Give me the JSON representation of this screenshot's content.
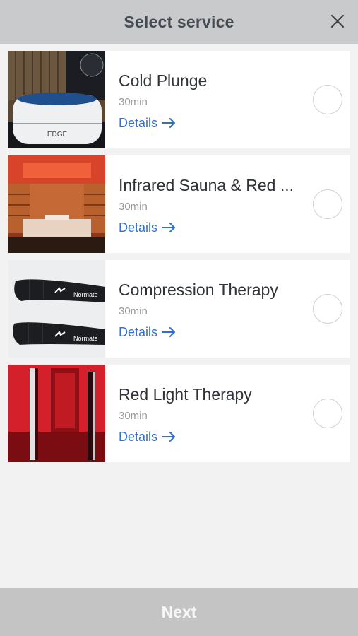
{
  "header": {
    "title": "Select service",
    "close_icon": "close-icon"
  },
  "services": [
    {
      "title": "Cold Plunge",
      "duration": "30min",
      "details": "Details",
      "image": "cold-plunge-tub-image"
    },
    {
      "title": "Infrared Sauna & Red ...",
      "duration": "30min",
      "details": "Details",
      "image": "infrared-sauna-image"
    },
    {
      "title": "Compression Therapy",
      "duration": "30min",
      "details": "Details",
      "image": "compression-boots-image"
    },
    {
      "title": "Red Light Therapy",
      "duration": "30min",
      "details": "Details",
      "image": "red-light-room-image"
    }
  ],
  "footer": {
    "next_label": "Next"
  },
  "colors": {
    "header_bg": "#c9cacb",
    "link": "#2f6fd6",
    "footer_bg": "#c4c4c4",
    "page_bg": "#f2f2f2"
  }
}
